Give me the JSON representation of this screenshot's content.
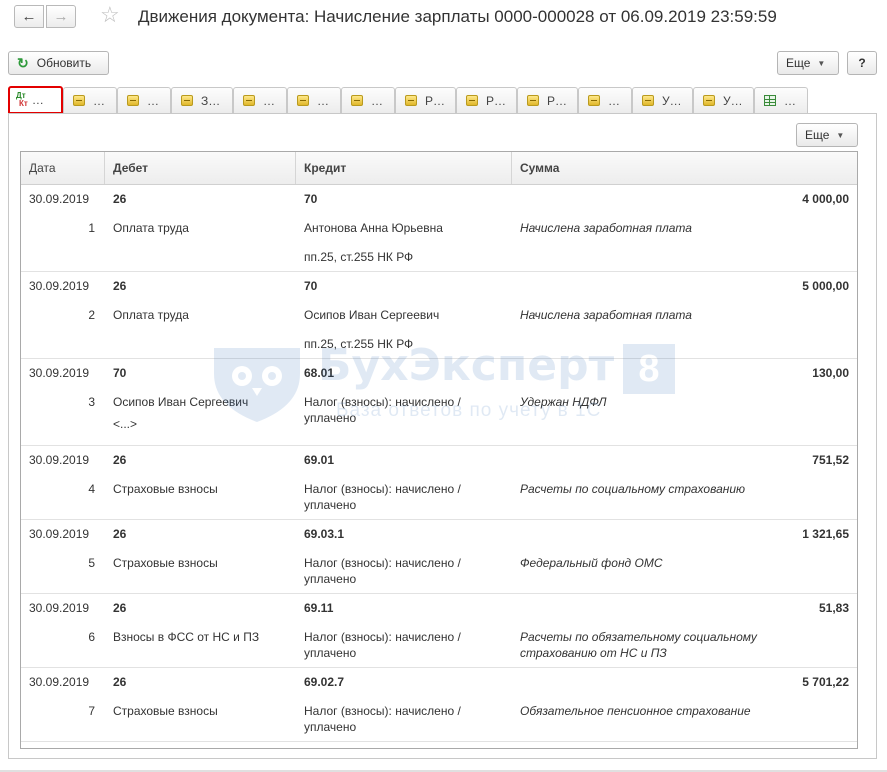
{
  "window": {
    "title": "Движения документа: Начисление зарплаты 0000-000028 от 06.09.2019 23:59:59"
  },
  "toolbar": {
    "refresh_label": "Обновить",
    "more_label": "Еще",
    "help_label": "?"
  },
  "tabs": [
    {
      "label": "…",
      "icon": "dt-kt-icon",
      "active": true
    },
    {
      "label": "…",
      "icon": "register-icon"
    },
    {
      "label": "…",
      "icon": "register-icon"
    },
    {
      "label": "З…",
      "icon": "register-icon"
    },
    {
      "label": "…",
      "icon": "register-icon"
    },
    {
      "label": "…",
      "icon": "register-icon"
    },
    {
      "label": "…",
      "icon": "register-icon"
    },
    {
      "label": "Р…",
      "icon": "register-icon"
    },
    {
      "label": "Р…",
      "icon": "register-icon"
    },
    {
      "label": "Р…",
      "icon": "register-icon"
    },
    {
      "label": "…",
      "icon": "register-icon"
    },
    {
      "label": "У…",
      "icon": "register-icon"
    },
    {
      "label": "У…",
      "icon": "register-icon"
    },
    {
      "label": "…",
      "icon": "table-icon"
    }
  ],
  "panel": {
    "more_label": "Еще"
  },
  "table": {
    "columns": [
      "Дата",
      "Дебет",
      "Кредит",
      "Сумма"
    ],
    "rows": [
      {
        "date": "30.09.2019",
        "num": "1",
        "debit_account": "26",
        "debit_sub": [
          "Оплата труда"
        ],
        "credit_account": "70",
        "credit_sub": [
          "Антонова Анна Юрьевна",
          "пп.25, ст.255 НК РФ"
        ],
        "description": "Начислена заработная плата",
        "amount": "4 000,00"
      },
      {
        "date": "30.09.2019",
        "num": "2",
        "debit_account": "26",
        "debit_sub": [
          "Оплата труда"
        ],
        "credit_account": "70",
        "credit_sub": [
          "Осипов Иван Сергеевич",
          "пп.25, ст.255 НК РФ"
        ],
        "description": "Начислена заработная плата",
        "amount": "5 000,00"
      },
      {
        "date": "30.09.2019",
        "num": "3",
        "debit_account": "70",
        "debit_sub": [
          "Осипов Иван Сергеевич",
          "<...>"
        ],
        "credit_account": "68.01",
        "credit_sub": [
          "Налог (взносы): начислено / уплачено"
        ],
        "description": "Удержан НДФЛ",
        "amount": "130,00"
      },
      {
        "date": "30.09.2019",
        "num": "4",
        "debit_account": "26",
        "debit_sub": [
          "Страховые взносы"
        ],
        "credit_account": "69.01",
        "credit_sub": [
          "Налог (взносы): начислено / уплачено"
        ],
        "description": "Расчеты по социальному страхованию",
        "amount": "751,52"
      },
      {
        "date": "30.09.2019",
        "num": "5",
        "debit_account": "26",
        "debit_sub": [
          "Страховые взносы"
        ],
        "credit_account": "69.03.1",
        "credit_sub": [
          "Налог (взносы): начислено / уплачено"
        ],
        "description": "Федеральный фонд ОМС",
        "amount": "1 321,65"
      },
      {
        "date": "30.09.2019",
        "num": "6",
        "debit_account": "26",
        "debit_sub": [
          "Взносы в ФСС от НС и ПЗ"
        ],
        "credit_account": "69.11",
        "credit_sub": [
          "Налог (взносы): начислено / уплачено"
        ],
        "description": "Расчеты по обязательному социальному страхованию от НС и ПЗ",
        "amount": "51,83"
      },
      {
        "date": "30.09.2019",
        "num": "7",
        "debit_account": "26",
        "debit_sub": [
          "Страховые взносы"
        ],
        "credit_account": "69.02.7",
        "credit_sub": [
          "Налог (взносы): начислено / уплачено"
        ],
        "description": "Обязательное пенсионное страхование",
        "amount": "5 701,22"
      }
    ]
  },
  "watermark": {
    "brand": "БухЭксперт",
    "digit": "8",
    "tagline": "База ответов по учету в 1С"
  },
  "colors": {
    "active_tab_border": "#e30000",
    "refresh_icon": "#2e9a3a",
    "watermark": "#1a5fb0"
  }
}
